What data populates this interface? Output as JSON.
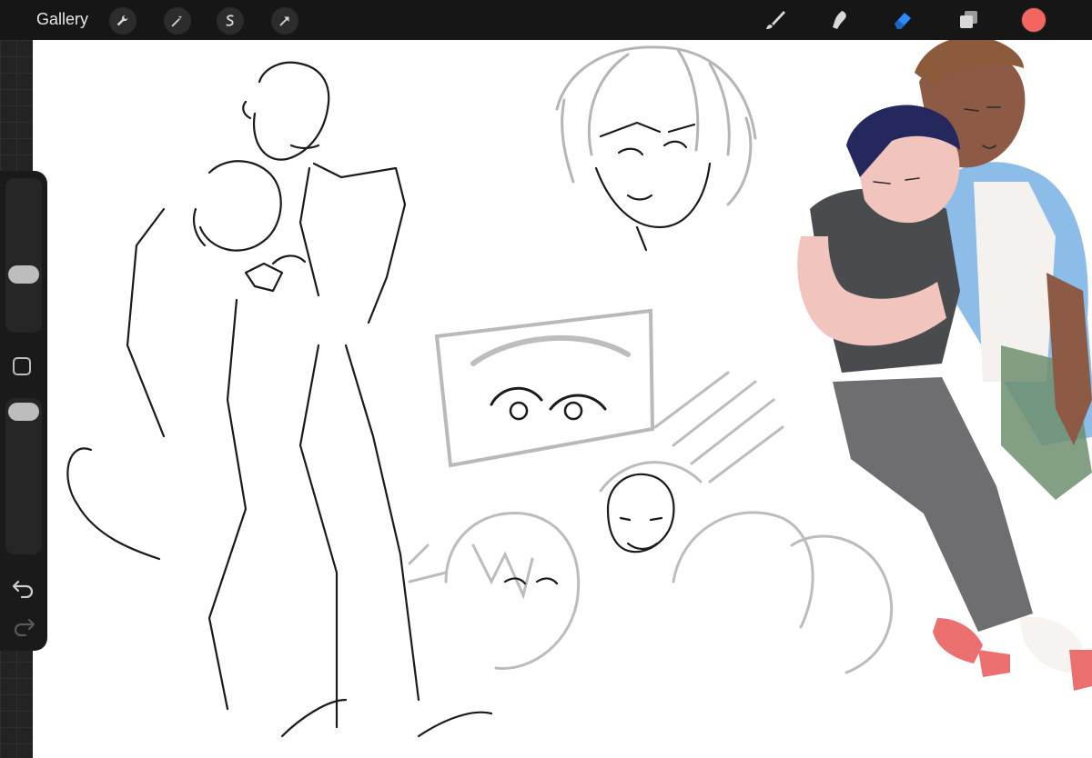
{
  "toolbar": {
    "gallery_label": "Gallery",
    "left_tools": [
      "wrench-icon",
      "magic-wand-icon",
      "selection-icon",
      "transform-arrow-icon"
    ],
    "right_tools": [
      "brush-icon",
      "smudge-icon",
      "eraser-icon",
      "layers-icon"
    ],
    "active_tool": "eraser-icon",
    "active_color": "#f2665f",
    "accent": "#2f8cff"
  },
  "sidebar": {
    "brush_size_level": 0.52,
    "opacity_level": 0.95,
    "controls": [
      "size-slider",
      "modifier-button",
      "opacity-slider",
      "undo-icon",
      "redo-icon"
    ]
  },
  "canvas": {
    "background": "#ffffff",
    "description_colors": {
      "line_black": "#1a1a1a",
      "sketch_grey": "#b9b9b9",
      "shirt": "#4a4b4f",
      "jeans": "#6e6e70",
      "hair_blue": "#24285c",
      "skin_light": "#f1c4bd",
      "skin_dark": "#8d5a45",
      "sleeve_blue": "#7fb5e6",
      "pants_green": "#6f8f6e",
      "socks_red": "#ec6f6f"
    }
  }
}
